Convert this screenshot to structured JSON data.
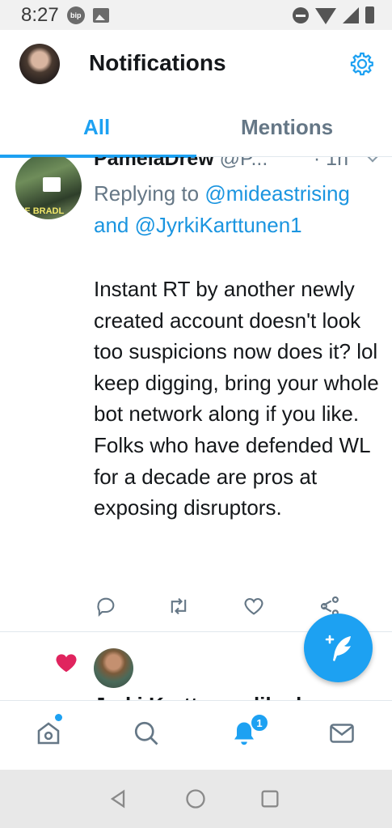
{
  "status_bar": {
    "time": "8:27",
    "bip_label": "bip"
  },
  "header": {
    "title": "Notifications"
  },
  "tabs": [
    {
      "label": "All",
      "active": true
    },
    {
      "label": "Mentions",
      "active": false
    }
  ],
  "tweet": {
    "name": "PamelaDrew",
    "handle": "@P...",
    "time": "· 1h",
    "avatar_sign_text": "EE BRADL",
    "reply_prefix": "Replying to",
    "reply_link_1": "@mideastrising",
    "reply_and": " and ",
    "reply_link_2": "@JyrkiKarttunen1",
    "body": "Instant RT by another newly created account doesn't look too suspicions now does it? lol keep digging, bring your whole bot network along if you like. Folks who have defended WL for a decade are pros at exposing disruptors."
  },
  "like_notification": {
    "partial_text": "Jyrki Karttunen liked"
  },
  "bottom_nav": {
    "notification_count": "1"
  },
  "colors": {
    "accent": "#1da1f2",
    "link": "#1b95e0",
    "secondary_text": "#657786",
    "like_heart": "#e0245e"
  }
}
